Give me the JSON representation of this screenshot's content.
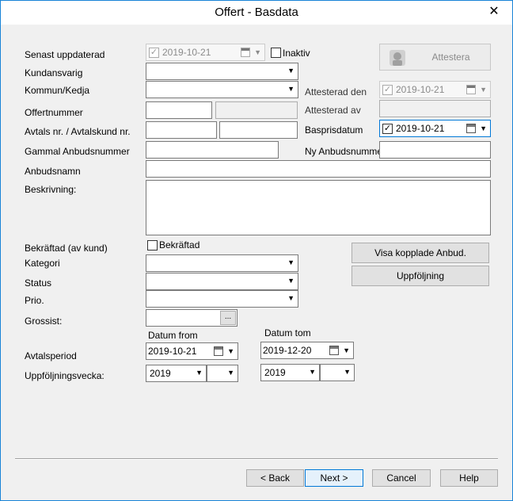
{
  "window": {
    "title": "Offert - Basdata",
    "close": "✕"
  },
  "labels": {
    "senast_uppdaterad": "Senast uppdaterad",
    "kundansvarig": "Kundansvarig",
    "kommun_kedja": "Kommun/Kedja",
    "offertnummer": "Offertnummer",
    "avtals_nr": "Avtals nr. / Avtalskund nr.",
    "gammal_anbudsnummer": "Gammal Anbudsnummer",
    "anbudsnamn": "Anbudsnamn",
    "beskrivning": "Beskrivning:",
    "bekraftad_av_kund": "Bekräftad (av kund)",
    "kategori": "Kategori",
    "status": "Status",
    "prio": "Prio.",
    "grossist": "Grossist:",
    "datum_from": "Datum from",
    "datum_tom": "Datum tom",
    "avtalsperiod": "Avtalsperiod",
    "uppfoljningsvecka": "Uppföljningsvecka:",
    "attesterad_den": "Attesterad den",
    "attesterad_av": "Attesterad av",
    "baspris_datum": "Baspris­datum",
    "ny_anbudsnummer": "Ny Anbudsnummer"
  },
  "fields": {
    "senast_uppdaterad": "2019-10-21",
    "inaktiv_label": "Inaktiv",
    "attesterad_den": "2019-10-21",
    "baspris_datum": "2019-10-21",
    "bekraftad_label": "Bekräftad",
    "grossist_btn": "...",
    "avtalsperiod_from": "2019-10-21",
    "avtalsperiod_tom": "2019-12-20",
    "uppf_year_from": "2019",
    "uppf_year_tom": "2019",
    "check_mark": "✓",
    "dropdown": "▼"
  },
  "buttons": {
    "attestera": "Attestera",
    "visa_kopplade": "Visa kopplade Anbud.",
    "uppfoljning": "Uppföljning",
    "back": "< Back",
    "next": "Next >",
    "cancel": "Cancel",
    "help": "Help"
  }
}
